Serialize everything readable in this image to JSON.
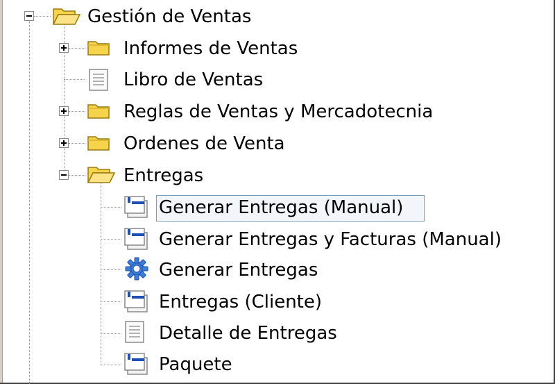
{
  "tree": {
    "root": {
      "label": "Gestión de Ventas",
      "icon": "folder-open-icon",
      "expanded": true
    },
    "items": [
      {
        "label": "Informes de Ventas",
        "icon": "folder-icon",
        "expander": "plus"
      },
      {
        "label": "Libro de Ventas",
        "icon": "document-icon"
      },
      {
        "label": "Reglas de Ventas y Mercadotecnia",
        "icon": "folder-icon",
        "expander": "plus"
      },
      {
        "label": "Ordenes de Venta",
        "icon": "folder-icon",
        "expander": "plus"
      },
      {
        "label": "Entregas",
        "icon": "folder-open-icon",
        "expander": "minus",
        "children": [
          {
            "label": "Generar Entregas (Manual)",
            "icon": "window-form-icon",
            "selected": true
          },
          {
            "label": "Generar Entregas y Facturas (Manual)",
            "icon": "window-form-icon"
          },
          {
            "label": "Generar Entregas",
            "icon": "process-gear-icon"
          },
          {
            "label": "Entregas (Cliente)",
            "icon": "window-form-icon"
          },
          {
            "label": "Detalle de Entregas",
            "icon": "document-icon"
          },
          {
            "label": "Paquete",
            "icon": "window-form-icon"
          }
        ]
      }
    ]
  },
  "colors": {
    "selection_border": "#7b9ebd",
    "folder_fill": "#f5d34a",
    "folder_stroke": "#9c7a12",
    "gear": "#3d7fd6",
    "window_blue": "#1f4fb5"
  }
}
